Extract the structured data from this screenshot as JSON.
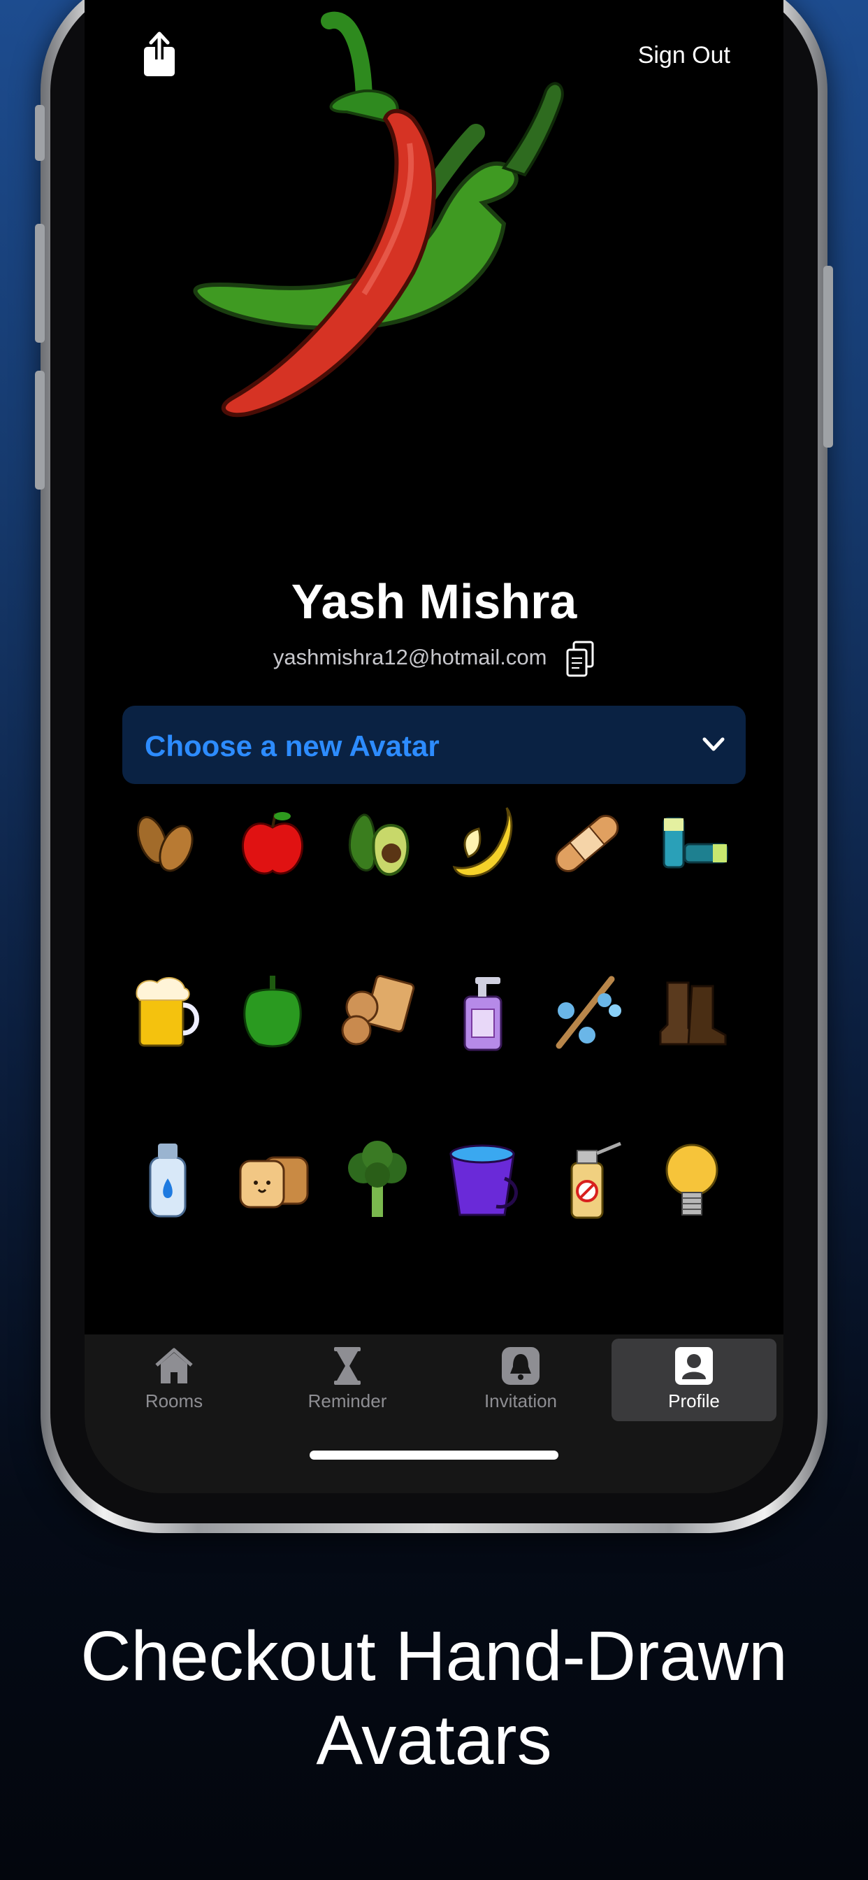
{
  "header": {
    "share_icon": "share-icon",
    "sign_out_label": "Sign Out"
  },
  "profile": {
    "name": "Yash Mishra",
    "email": "yashmishra12@hotmail.com",
    "copy_icon": "copy-icon",
    "hero_avatar": "chili-peppers"
  },
  "avatar_picker": {
    "label": "Choose a new Avatar",
    "chevron_icon": "chevron-down-icon",
    "avatars": [
      "almonds",
      "apple",
      "avocado",
      "banana",
      "bandage",
      "batteries",
      "beer",
      "bell-pepper",
      "biscuits",
      "soap-dispenser",
      "broom",
      "boots",
      "bottle",
      "bread",
      "broccoli",
      "bucket",
      "bug-spray",
      "light-bulb"
    ]
  },
  "tabbar": {
    "tabs": [
      {
        "label": "Rooms",
        "icon": "house-icon"
      },
      {
        "label": "Reminder",
        "icon": "hourglass-icon"
      },
      {
        "label": "Invitation",
        "icon": "bell-icon"
      },
      {
        "label": "Profile",
        "icon": "person-icon"
      }
    ],
    "active": "Profile"
  },
  "caption": {
    "line1": "Checkout Hand-Drawn",
    "line2": "Avatars"
  },
  "colors": {
    "accent": "#2d8cff",
    "dropdown_bg": "#0a2243",
    "screen_bg": "#000000"
  }
}
